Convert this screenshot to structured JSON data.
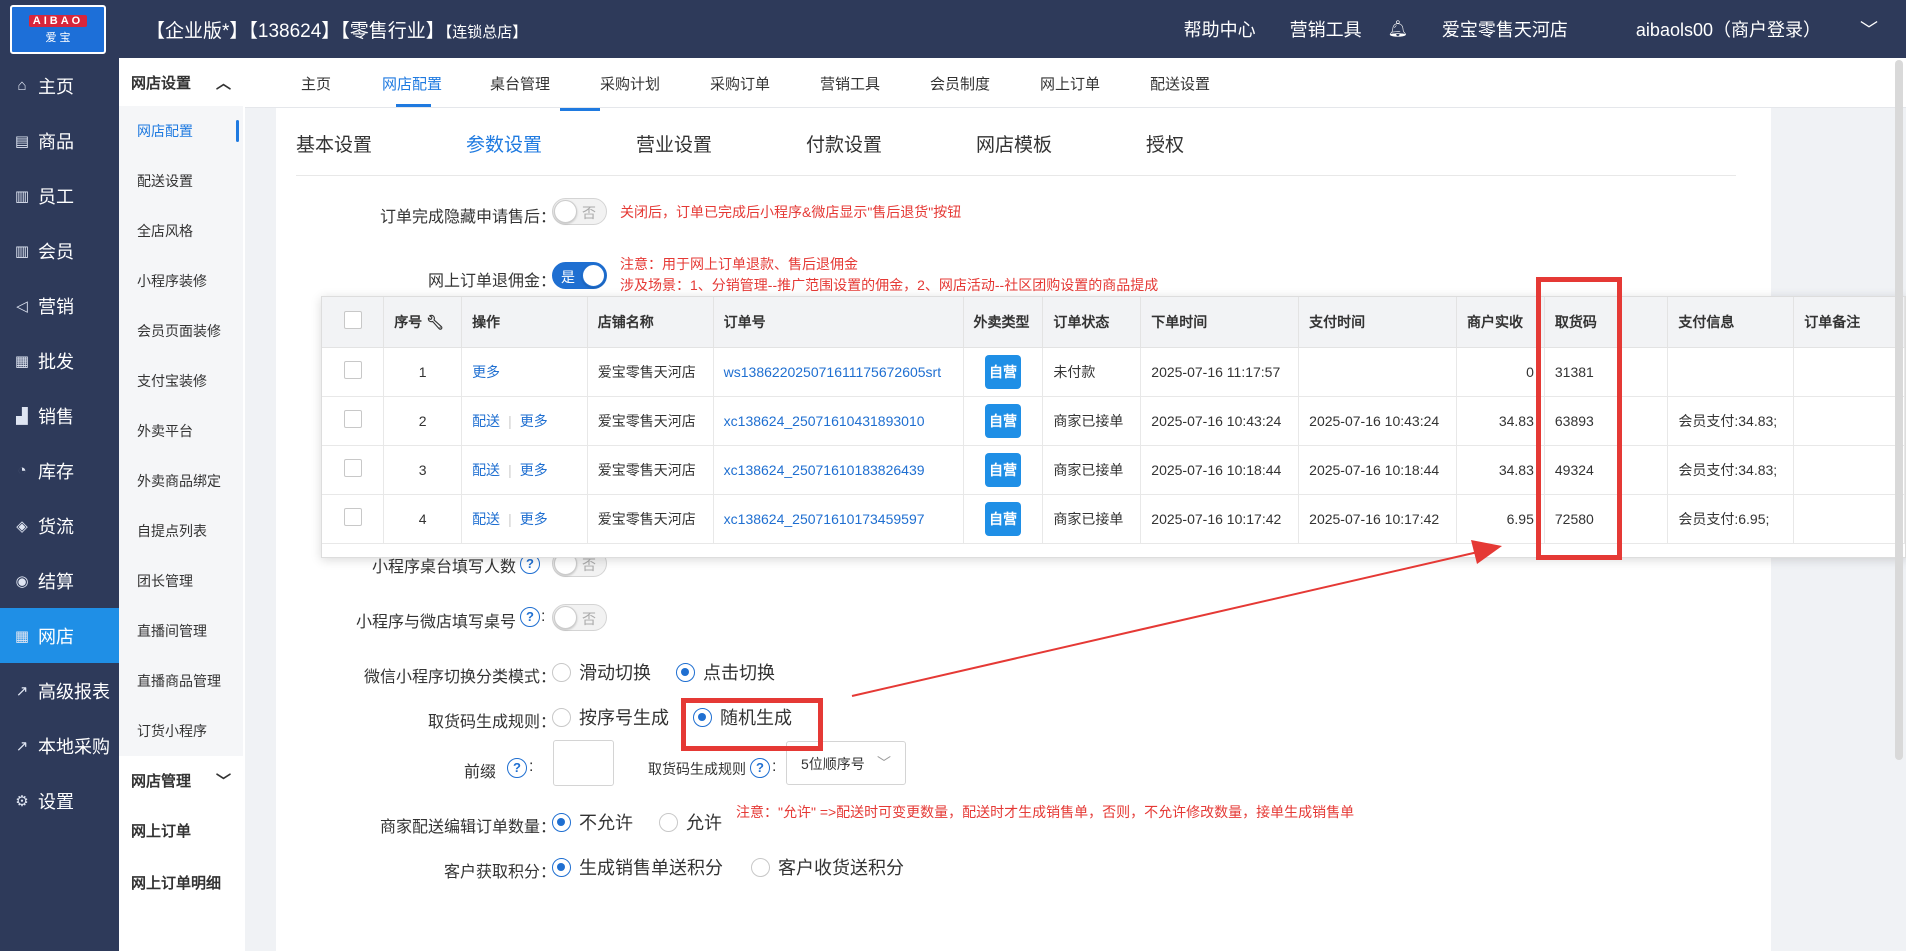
{
  "header": {
    "logo_top": "AIBAO",
    "logo_bottom": "爱 宝",
    "title_main": "【企业版*】【138624】【零售行业】",
    "title_small": "【连锁总店】",
    "help_center": "帮助中心",
    "marketing_tool": "营销工具",
    "store_name": "爱宝零售天河店",
    "user": "aibaols00（商户登录）"
  },
  "leftnav": {
    "items": [
      {
        "label": "主页",
        "icon": "home-icon"
      },
      {
        "label": "商品",
        "icon": "goods-icon"
      },
      {
        "label": "员工",
        "icon": "staff-icon"
      },
      {
        "label": "会员",
        "icon": "member-icon"
      },
      {
        "label": "营销",
        "icon": "megaphone-icon"
      },
      {
        "label": "批发",
        "icon": "wholesale-icon"
      },
      {
        "label": "销售",
        "icon": "chart-icon"
      },
      {
        "label": "库存",
        "icon": "stock-icon"
      },
      {
        "label": "货流",
        "icon": "flow-icon"
      },
      {
        "label": "结算",
        "icon": "settle-icon"
      },
      {
        "label": "网店",
        "icon": "shop-icon"
      },
      {
        "label": "高级报表",
        "icon": "report-icon"
      },
      {
        "label": "本地采购",
        "icon": "purchase-icon"
      },
      {
        "label": "设置",
        "icon": "gear-icon"
      }
    ]
  },
  "subnav": {
    "group1": "网店设置",
    "items": [
      "网店配置",
      "配送设置",
      "全店风格",
      "小程序装修",
      "会员页面装修",
      "支付宝装修",
      "外卖平台",
      "外卖商品绑定",
      "自提点列表",
      "团长管理",
      "直播间管理",
      "直播商品管理",
      "订货小程序"
    ],
    "group2": "网店管理",
    "items2": [
      "网上订单",
      "网上订单明细"
    ]
  },
  "htabs": [
    "主页",
    "网店配置",
    "桌台管理",
    "采购计划",
    "采购订单",
    "营销工具",
    "会员制度",
    "网上订单",
    "配送设置"
  ],
  "ptabs": [
    "基本设置",
    "参数设置",
    "营业设置",
    "付款设置",
    "网店模板",
    "授权"
  ],
  "form": {
    "hide_after_sale_label": "订单完成隐藏申请售后：",
    "hide_after_sale_toggle": "否",
    "hide_after_sale_note": "关闭后，订单已完成后小程序&微店显示\"售后退货\"按钮",
    "refund_commission_label": "网上订单退佣金：",
    "refund_commission_toggle": "是",
    "refund_note1": "注意：用于网上订单退款、售后退佣金",
    "refund_note2": "涉及场景：1、分销管理--推广范围设置的佣金，2、网店活动--社区团购设置的商品提成",
    "table_people_label": "小程序桌台填写人数",
    "table_people_toggle": "否",
    "table_number_label": "小程序与微店填写桌号",
    "table_number_toggle": "否",
    "switch_mode_label": "微信小程序切换分类模式：",
    "switch_mode_opt1": "滑动切换",
    "switch_mode_opt2": "点击切换",
    "pickup_rule_label": "取货码生成规则：",
    "pickup_rule_opt1": "按序号生成",
    "pickup_rule_opt2": "随机生成",
    "prefix_label": "前缀",
    "pickup_gen_label": "取货码生成规则",
    "pickup_gen_value": "5位顺序号",
    "edit_qty_label": "商家配送编辑订单数量：",
    "edit_qty_opt1": "不允许",
    "edit_qty_opt2": "允许",
    "edit_qty_note": "注意：\"允许\" =>配送时可变更数量，配送时才生成销售单，否则，不允许修改数量，接单生成销售单",
    "points_label": "客户获取积分：",
    "points_opt1": "生成销售单送积分",
    "points_opt2": "客户收货送积分"
  },
  "orders": {
    "columns": [
      "序号",
      "操作",
      "店铺名称",
      "订单号",
      "外卖类型",
      "订单状态",
      "下单时间",
      "支付时间",
      "商户实收",
      "取货码",
      "支付信息",
      "订单备注"
    ],
    "rows": [
      {
        "no": "1",
        "op1": "更多",
        "op2": "",
        "shop": "爱宝零售天河店",
        "order": "ws138622025071611175672605srt",
        "type": "自营",
        "status": "未付款",
        "created": "2025-07-16 11:17:57",
        "paid": "",
        "amount": "0",
        "code": "31381",
        "payinfo": "",
        "remark": ""
      },
      {
        "no": "2",
        "op1": "配送",
        "op2": "更多",
        "shop": "爱宝零售天河店",
        "order": "xc138624_25071610431893010",
        "type": "自营",
        "status": "商家已接单",
        "created": "2025-07-16 10:43:24",
        "paid": "2025-07-16 10:43:24",
        "amount": "34.83",
        "code": "63893",
        "payinfo": "会员支付:34.83;",
        "remark": ""
      },
      {
        "no": "3",
        "op1": "配送",
        "op2": "更多",
        "shop": "爱宝零售天河店",
        "order": "xc138624_25071610183826439",
        "type": "自营",
        "status": "商家已接单",
        "created": "2025-07-16 10:18:44",
        "paid": "2025-07-16 10:18:44",
        "amount": "34.83",
        "code": "49324",
        "payinfo": "会员支付:34.83;",
        "remark": ""
      },
      {
        "no": "4",
        "op1": "配送",
        "op2": "更多",
        "shop": "爱宝零售天河店",
        "order": "xc138624_25071610173459597",
        "type": "自营",
        "status": "商家已接单",
        "created": "2025-07-16 10:17:42",
        "paid": "2025-07-16 10:17:42",
        "amount": "6.95",
        "code": "72580",
        "payinfo": "会员支付:6.95;",
        "remark": ""
      }
    ]
  },
  "colors": {
    "accent": "#1f7ae0",
    "nav_bg": "#2e3a5a",
    "highlight": "#e53935"
  }
}
